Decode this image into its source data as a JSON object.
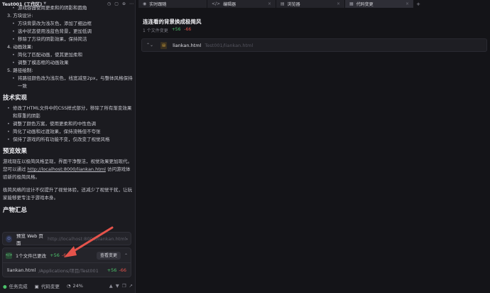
{
  "workspace": {
    "title": "Test001 (工作区)"
  },
  "chat": {
    "top_cut_line": "游戏容器使用更柔和的阴影和圆角",
    "section3": {
      "label": "3. 方块设计:",
      "items": [
        "方块背景改为浅灰色，添加了细边框",
        "选中状态使用浅蓝色背景，更加低调",
        "移除了方块的阴影效果，保持简洁"
      ]
    },
    "section4": {
      "label": "4. 动画效果:",
      "items": [
        "简化了匹配动画，使其更加柔和",
        "调整了模态框的动画效果"
      ]
    },
    "section5": {
      "label": "5. 路径绘制:",
      "items": [
        "将路径颜色改为浅灰色，线宽减至2px，与整体风格保持一致"
      ]
    },
    "tech": {
      "heading": "技术实现",
      "items": [
        "修改了HTML文件中的CSS样式部分，移除了所有渐变效果和厚重的阴影",
        "调整了颜色方案，使用更柔和的中性色调",
        "简化了动画和过渡效果，保持流畅但不夸张",
        "保持了游戏的所有功能不变，仅改变了视觉风格"
      ]
    },
    "preview": {
      "heading": "预览效果",
      "p1_before": "游戏现在以极简风格呈现，界面干净整洁，视觉效果更加现代。您可以通过 ",
      "p1_link": "http://localhost:8000/liankan.html",
      "p1_after": " 访问游戏体验新的极简风格。",
      "p2": "极简风格的设计不仅提升了视觉体验，还减少了视觉干扰，让玩家能够更专注于游戏本身。"
    },
    "artifacts": {
      "heading": "产物汇总",
      "preview_card": {
        "label": "预览 Web 页面",
        "url": "http://localhost:8000/liankan.html"
      },
      "changes_card": {
        "label": "1个文件已更改",
        "added": "+56",
        "removed": "-66",
        "view_button": "查看变更",
        "file_name": "liankan.html",
        "file_path": "/Applications/项目/Test001/liankan...",
        "file_added": "+56",
        "file_removed": "-66"
      }
    },
    "status": {
      "task": "任务完成",
      "code_changes": "代码变更",
      "progress": "24%"
    }
  },
  "tabs": [
    {
      "label": "实时跟随",
      "icon": "follow-icon"
    },
    {
      "label": "编辑器",
      "icon": "code-icon"
    },
    {
      "label": "浏览器",
      "icon": "browser-icon"
    },
    {
      "label": "代码变更",
      "icon": "diff-icon"
    }
  ],
  "diff_panel": {
    "title": "连连看的背景换成极简风",
    "file_count": "1 个文件变更",
    "added": "+56",
    "removed": "-66",
    "file": {
      "name": "liankan.html",
      "path": "Test001/liankan.html"
    }
  },
  "colors": {
    "accent_red": "#e5534b",
    "added_green": "#4cc26b",
    "removed_red": "#e5534b"
  }
}
